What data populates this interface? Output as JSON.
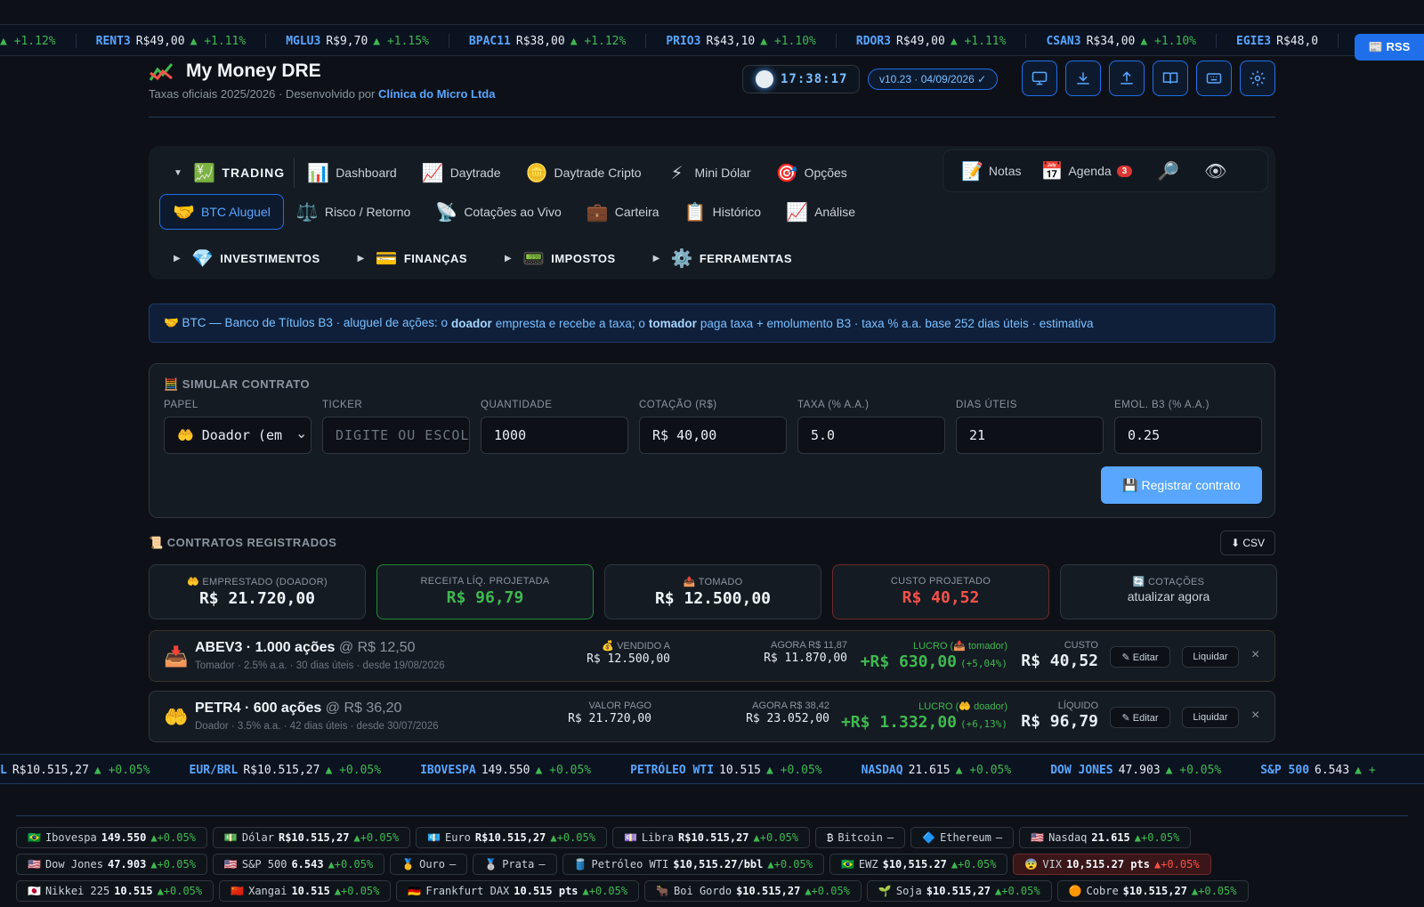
{
  "top_ticker": [
    {
      "sym": "",
      "price": "",
      "chg": "▲ +1.12%"
    },
    {
      "sym": "RENT3",
      "price": "R$49,00",
      "chg": "▲ +1.11%"
    },
    {
      "sym": "MGLU3",
      "price": "R$9,70",
      "chg": "▲ +1.15%"
    },
    {
      "sym": "BPAC11",
      "price": "R$38,00",
      "chg": "▲ +1.12%"
    },
    {
      "sym": "PRIO3",
      "price": "R$43,10",
      "chg": "▲ +1.10%"
    },
    {
      "sym": "RDOR3",
      "price": "R$49,00",
      "chg": "▲ +1.11%"
    },
    {
      "sym": "CSAN3",
      "price": "R$34,00",
      "chg": "▲ +1.10%"
    },
    {
      "sym": "EGIE3",
      "price": "R$48,0",
      "chg": ""
    }
  ],
  "rss_label": "📰 RSS",
  "header": {
    "title": "My Money DRE",
    "subtitle_prefix": "Taxas oficiais 2025/2026 · Desenvolvido por ",
    "subtitle_company": "Clínica do Micro Ltda",
    "clock": "17:38:17",
    "version": "v10.23 · 04/09/2026 ✓"
  },
  "nav": {
    "trading_group": "TRADING",
    "trading_icon": "💹",
    "row1": [
      {
        "icon": "📊",
        "label": "Dashboard"
      },
      {
        "icon": "📈",
        "label": "Daytrade"
      },
      {
        "icon": "🪙",
        "label": "Daytrade Cripto"
      },
      {
        "icon": "⚡",
        "label": "Mini Dólar"
      },
      {
        "icon": "🎯",
        "label": "Opções"
      }
    ],
    "row2": [
      {
        "icon": "🤝",
        "label": "BTC Aluguel"
      },
      {
        "icon": "⚖️",
        "label": "Risco / Retorno"
      },
      {
        "icon": "📡",
        "label": "Cotações ao Vivo"
      },
      {
        "icon": "💼",
        "label": "Carteira"
      },
      {
        "icon": "📋",
        "label": "Histórico"
      },
      {
        "icon": "📈",
        "label": "Análise"
      }
    ],
    "groups": [
      {
        "icon": "💎",
        "label": "INVESTIMENTOS"
      },
      {
        "icon": "💳",
        "label": "FINANÇAS"
      },
      {
        "icon": "📟",
        "label": "IMPOSTOS"
      },
      {
        "icon": "⚙️",
        "label": "FERRAMENTAS"
      }
    ],
    "right": {
      "notes_icon": "📝",
      "notes": "Notas",
      "agenda_icon": "📅",
      "agenda": "Agenda",
      "agenda_badge": "3",
      "search_icon": "🔎",
      "eye_icon": "👁"
    }
  },
  "banner": {
    "prefix": "🤝 BTC — Banco de Títulos B3 · aluguel de ações: o ",
    "doador": "doador",
    "mid": " empresta e recebe a taxa; o ",
    "tomador": "tomador",
    "suffix": " paga taxa + emolumento B3 · taxa % a.a. base 252 dias úteis · estimativa"
  },
  "simulator": {
    "title": "🧮 SIMULAR CONTRATO",
    "fields": [
      {
        "label": "PAPEL",
        "value": "🤲 Doador (em"
      },
      {
        "label": "TICKER",
        "placeholder": "DIGITE OU ESCOLHA"
      },
      {
        "label": "QUANTIDADE",
        "value": "1000"
      },
      {
        "label": "COTAÇÃO (R$)",
        "value": "R$ 40,00"
      },
      {
        "label": "TAXA (% A.A.)",
        "value": "5.0"
      },
      {
        "label": "DIAS ÚTEIS",
        "value": "21"
      },
      {
        "label": "EMOL. B3 (% A.A.)",
        "value": "0.25"
      }
    ],
    "register_button": "💾 Registrar contrato"
  },
  "contracts": {
    "title": "📜 CONTRATOS REGISTRADOS",
    "csv_button": "⬇ CSV",
    "kpis": [
      {
        "label": "🤲 EMPRESTADO (DOADOR)",
        "value": "R$ 21.720,00"
      },
      {
        "label": "RECEITA LÍQ. PROJETADA",
        "value": "R$ 96,79"
      },
      {
        "label": "📤 TOMADO",
        "value": "R$ 12.500,00"
      },
      {
        "label": "CUSTO PROJETADO",
        "value": "R$ 40,52"
      },
      {
        "label": "🔄 COTAÇÕES",
        "value": "atualizar agora"
      }
    ],
    "rows": [
      {
        "icon": "📥",
        "title": "ABEV3 · 1.000 ações",
        "at": "@ R$ 12,50",
        "meta": "Tomador · 2.5% a.a. · 30 dias úteis · desde 19/08/2026",
        "c1_label": "💰 VENDIDO A",
        "c1_value": "R$ 12.500,00",
        "c2_label": "AGORA R$ 11,87",
        "c2_value": "R$ 11.870,00",
        "c3_label": "LUCRO (📤 tomador)",
        "c3_value": "+R$ 630,00",
        "c3_pct": "(+5,04%)",
        "c4_label": "CUSTO",
        "c4_value": "R$ 40,52",
        "edit": "✎ Editar",
        "settle": "Liquidar",
        "close": "×"
      },
      {
        "icon": "🤲",
        "title": "PETR4 · 600 ações",
        "at": "@ R$ 36,20",
        "meta": "Doador · 3.5% a.a. · 42 dias úteis · desde 30/07/2026",
        "c1_label": "VALOR PAGO",
        "c1_value": "R$ 21.720,00",
        "c2_label": "AGORA R$ 38,42",
        "c2_value": "R$ 23.052,00",
        "c3_label": "LUCRO (🤲 doador)",
        "c3_value": "+R$ 1.332,00",
        "c3_pct": "(+6,13%)",
        "c4_label": "LÍQUIDO",
        "c4_value": "R$ 96,79",
        "edit": "✎ Editar",
        "settle": "Liquidar",
        "close": "×"
      }
    ]
  },
  "mid_ticker": [
    {
      "sym": "L",
      "price": "R$10.515,27",
      "chg": "▲ +0.05%"
    },
    {
      "sym": "EUR/BRL",
      "price": "R$10.515,27",
      "chg": "▲ +0.05%"
    },
    {
      "sym": "IBOVESPA",
      "price": "149.550",
      "chg": "▲ +0.05%"
    },
    {
      "sym": "PETRÓLEO WTI",
      "price": "10.515",
      "chg": "▲ +0.05%"
    },
    {
      "sym": "NASDAQ",
      "price": "21.615",
      "chg": "▲ +0.05%"
    },
    {
      "sym": "DOW JONES",
      "price": "47.903",
      "chg": "▲ +0.05%"
    },
    {
      "sym": "S&P 500",
      "price": "6.543",
      "chg": "▲ +"
    }
  ],
  "quotes": [
    [
      {
        "flag": "🇧🇷",
        "name": "Ibovespa",
        "price": "149.550",
        "chg": "▲+0.05%"
      },
      {
        "flag": "💵",
        "name": "Dólar",
        "price": "R$10.515,27",
        "chg": "▲+0.05%"
      },
      {
        "flag": "💶",
        "name": "Euro",
        "price": "R$10.515,27",
        "chg": "▲+0.05%"
      },
      {
        "flag": "💷",
        "name": "Libra",
        "price": "R$10.515,27",
        "chg": "▲+0.05%"
      },
      {
        "flag": "₿",
        "name": "Bitcoin",
        "price": "",
        "chg": "—"
      },
      {
        "flag": "🔷",
        "name": "Ethereum",
        "price": "",
        "chg": "—"
      },
      {
        "flag": "🇺🇸",
        "name": "Nasdaq",
        "price": "21.615",
        "chg": "▲+0.05%"
      }
    ],
    [
      {
        "flag": "🇺🇸",
        "name": "Dow Jones",
        "price": "47.903",
        "chg": "▲+0.05%"
      },
      {
        "flag": "🇺🇸",
        "name": "S&P 500",
        "price": "6.543",
        "chg": "▲+0.05%"
      },
      {
        "flag": "🥇",
        "name": "Ouro",
        "price": "",
        "chg": "—"
      },
      {
        "flag": "🥈",
        "name": "Prata",
        "price": "",
        "chg": "—"
      },
      {
        "flag": "🛢️",
        "name": "Petróleo WTI",
        "price": "$10,515.27/bbl",
        "chg": "▲+0.05%"
      },
      {
        "flag": "🇧🇷",
        "name": "EWZ",
        "price": "$10,515.27",
        "chg": "▲+0.05%"
      },
      {
        "flag": "😨",
        "name": "VIX",
        "price": "10,515.27 pts",
        "chg": "▲+0.05%",
        "alert": true
      }
    ],
    [
      {
        "flag": "🇯🇵",
        "name": "Nikkei 225",
        "price": "10.515",
        "chg": "▲+0.05%"
      },
      {
        "flag": "🇨🇳",
        "name": "Xangai",
        "price": "10.515",
        "chg": "▲+0.05%"
      },
      {
        "flag": "🇩🇪",
        "name": "Frankfurt DAX",
        "price": "10.515 pts",
        "chg": "▲+0.05%"
      },
      {
        "flag": "🐂",
        "name": "Boi Gordo",
        "price": "$10.515,27",
        "chg": "▲+0.05%"
      },
      {
        "flag": "🌱",
        "name": "Soja",
        "price": "$10.515,27",
        "chg": "▲+0.05%"
      },
      {
        "flag": "🟠",
        "name": "Cobre",
        "price": "$10.515,27",
        "chg": "▲+0.05%"
      }
    ]
  ],
  "colors": {
    "accent": "#58a6ff",
    "up": "#3fb950",
    "down": "#f85149",
    "bg": "#0d1117"
  }
}
